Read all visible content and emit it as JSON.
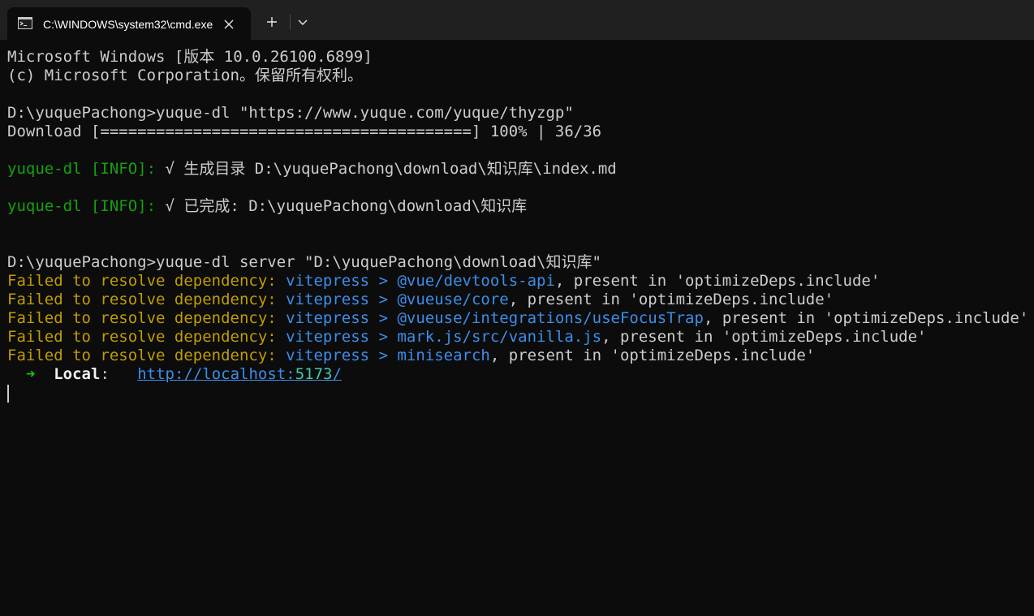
{
  "tab": {
    "title": "C:\\WINDOWS\\system32\\cmd.exe",
    "icon": "cmd-icon",
    "close_icon": "close-icon"
  },
  "tabbar": {
    "new_tab_icon": "plus-icon",
    "dropdown_icon": "chevron-down-icon"
  },
  "terminal": {
    "banner": {
      "line1": "Microsoft Windows [版本 10.0.26100.6899]",
      "line2": "(c) Microsoft Corporation。保留所有权利。"
    },
    "cmd1": "D:\\yuquePachong>yuque-dl \"https://www.yuque.com/yuque/thyzgp\"",
    "progress": "Download [========================================] 100% | 36/36",
    "info1": {
      "prefix": "yuque-dl [INFO]:",
      "text": " √ 生成目录 D:\\yuquePachong\\download\\知识库\\index.md"
    },
    "info2": {
      "prefix": "yuque-dl [INFO]:",
      "text": " √ 已完成: D:\\yuquePachong\\download\\知识库"
    },
    "cmd2": "D:\\yuquePachong>yuque-dl server \"D:\\yuquePachong\\download\\知识库\"",
    "failures": [
      {
        "prefix": "Failed to resolve dependency:",
        "dep": " vitepress > @vue/devtools-api",
        "suffix": ", present in 'optimizeDeps.include'"
      },
      {
        "prefix": "Failed to resolve dependency:",
        "dep": " vitepress > @vueuse/core",
        "suffix": ", present in 'optimizeDeps.include'"
      },
      {
        "prefix": "Failed to resolve dependency:",
        "dep": " vitepress > @vueuse/integrations/useFocusTrap",
        "suffix": ", present in 'optimizeDeps.include'"
      },
      {
        "prefix": "Failed to resolve dependency:",
        "dep": " vitepress > mark.js/src/vanilla.js",
        "suffix": ", present in 'optimizeDeps.include'"
      },
      {
        "prefix": "Failed to resolve dependency:",
        "dep": " vitepress > minisearch",
        "suffix": ", present in 'optimizeDeps.include'"
      }
    ],
    "local": {
      "arrow": "➜",
      "label": "Local",
      "colon": ":",
      "url_base": "http://localhost:",
      "port": "5173",
      "url_tail": "/"
    }
  },
  "colors": {
    "background": "#0c0c0c",
    "tabbar": "#202020",
    "text": "#cccccc",
    "green": "#13a10e",
    "yellow": "#c19c00",
    "blue": "#3b8eea",
    "cyan": "#3fc9b0"
  }
}
